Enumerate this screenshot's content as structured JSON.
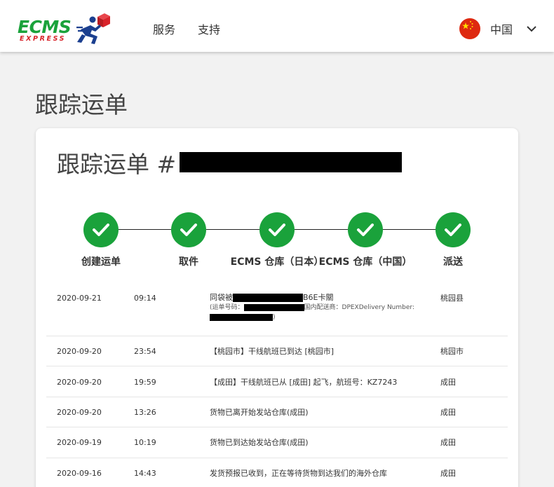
{
  "header": {
    "logo_main": "ECMS",
    "logo_sub": "EXPRESS",
    "nav": [
      "服务",
      "支持"
    ],
    "language": "中国",
    "flag_icon": "china-flag-icon",
    "chevron_icon": "chevron-down-icon"
  },
  "page": {
    "title": "跟踪运单",
    "card_title": "跟踪运单 #"
  },
  "colors": {
    "brand_green": "#1aa23b",
    "brand_red": "#d8232a",
    "brand_blue": "#1b3f8f"
  },
  "steps": [
    {
      "label": "创建运单",
      "done": true
    },
    {
      "label": "取件",
      "done": true
    },
    {
      "label": "ECMS 仓库（日本）",
      "done": true
    },
    {
      "label": "ECMS 仓库（中国）",
      "done": true
    },
    {
      "label": "派送",
      "done": true
    }
  ],
  "events": [
    {
      "date": "2020-09-21",
      "time": "09:14",
      "desc_prefix": "同袋被",
      "desc_suffix": "B6E卡關",
      "sub_prefix": "(运单号码：",
      "sub_middle": "国内配送商：DPEXDelivery Number:",
      "sub_end": ")",
      "location": "桃园县"
    },
    {
      "date": "2020-09-20",
      "time": "23:54",
      "desc": "【桃园市】干线航班已到达 [桃园市]",
      "location": "桃园市"
    },
    {
      "date": "2020-09-20",
      "time": "19:59",
      "desc": "【成田】干线航班已从 [成田] 起飞，航班号：KZ7243",
      "location": "成田"
    },
    {
      "date": "2020-09-20",
      "time": "13:26",
      "desc": "货物已离开始发站仓库(成田)",
      "location": "成田"
    },
    {
      "date": "2020-09-19",
      "time": "10:19",
      "desc": "货物已到达始发站仓库(成田)",
      "location": "成田"
    },
    {
      "date": "2020-09-16",
      "time": "14:43",
      "desc": "发货预报已收到，正在等待货物到达我们的海外仓库",
      "location": "成田"
    }
  ]
}
